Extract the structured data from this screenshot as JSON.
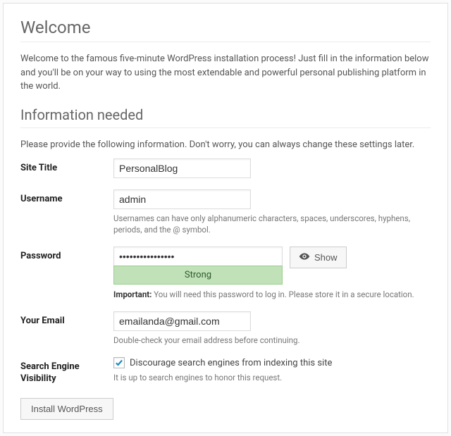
{
  "headings": {
    "welcome": "Welcome",
    "info_needed": "Information needed"
  },
  "paragraphs": {
    "intro": "Welcome to the famous five-minute WordPress installation process! Just fill in the information below and you'll be on your way to using the most extendable and powerful personal publishing platform in the world.",
    "info": "Please provide the following information. Don't worry, you can always change these settings later."
  },
  "fields": {
    "site_title": {
      "label": "Site Title",
      "value": "PersonalBlog"
    },
    "username": {
      "label": "Username",
      "value": "admin",
      "help": "Usernames can have only alphanumeric characters, spaces, underscores, hyphens, periods, and the @ symbol."
    },
    "password": {
      "label": "Password",
      "value": "••••••••••••••••",
      "show_label": "Show",
      "strength": "Strong",
      "important_label": "Important:",
      "important_text": " You will need this password to log in. Please store it in a secure location."
    },
    "email": {
      "label": "Your Email",
      "value": "emailanda@gmail.com",
      "help": "Double-check your email address before continuing."
    },
    "search_engine": {
      "label": "Search Engine Visibility",
      "checkbox_label": "Discourage search engines from indexing this site",
      "checked": true,
      "help": "It is up to search engines to honor this request."
    }
  },
  "submit_label": "Install WordPress"
}
